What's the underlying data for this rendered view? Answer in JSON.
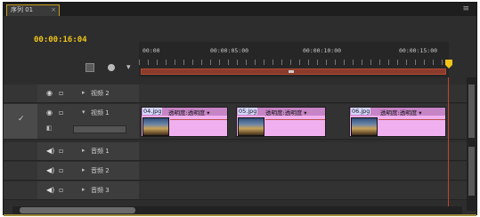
{
  "panel": {
    "tab_label": "序列 01",
    "tab_close": "×",
    "menu_icon": "≡"
  },
  "timecode": "00:00:16:04",
  "ruler": {
    "labels": [
      "00:00",
      "00:00:05:00",
      "00:00:10:00",
      "00:00:15:00"
    ]
  },
  "tracks": {
    "video2": {
      "name": "视频 2"
    },
    "video1": {
      "name": "视频 1",
      "check": "✓"
    },
    "audio1": {
      "name": "音频 1"
    },
    "audio2": {
      "name": "音频 2"
    },
    "audio3": {
      "name": "音频 3"
    }
  },
  "clips": [
    {
      "file": "04.jpg",
      "opacity": "透明度:透明度 ▾"
    },
    {
      "file": "05.jpg",
      "opacity": "透明度:透明度 ▾"
    },
    {
      "file": "06.jpg",
      "opacity": "透明度:透明度 ▾"
    }
  ],
  "icons": {
    "eye": "eye-icon",
    "speaker": "speaker-icon",
    "lock": "lock-icon",
    "twirl": "twirl-down-icon",
    "snap": "snap-icon",
    "marker": "marker-icon",
    "wrench": "wrench-icon"
  },
  "colors": {
    "timecode": "#f0c419",
    "clip": "#f0b0ef",
    "playhead": "#c9412c"
  }
}
